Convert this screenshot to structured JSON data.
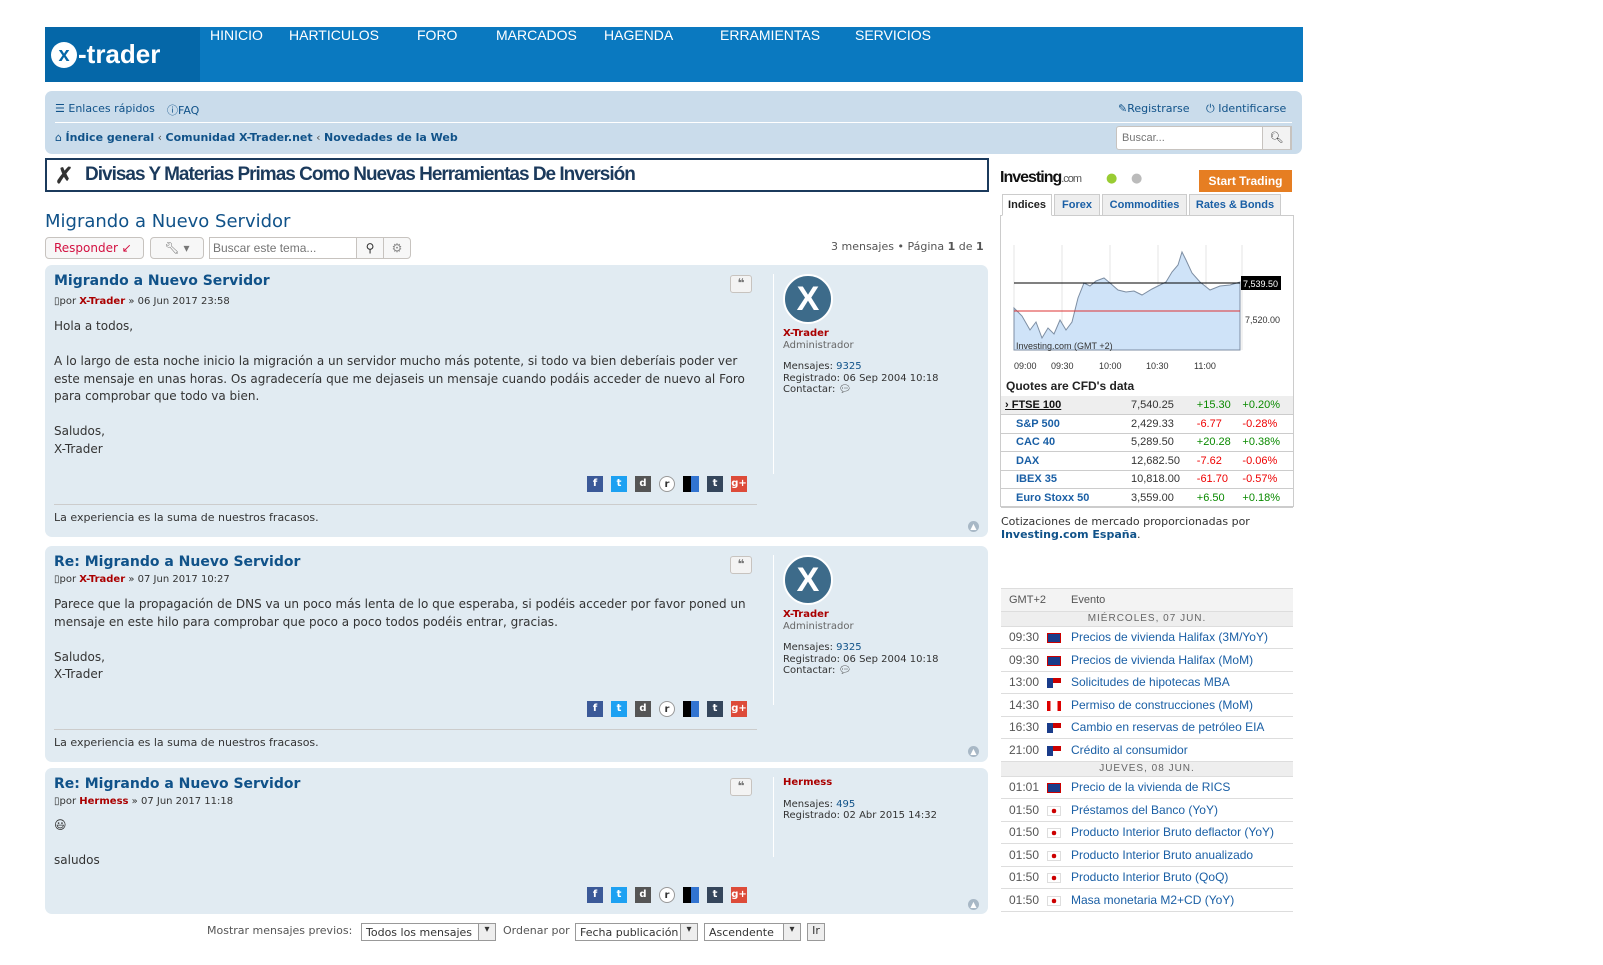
{
  "header": {
    "logo": "x-trader",
    "nav": [
      "HINICIO",
      "HARTICULOS",
      "FORO",
      "MARCADOS",
      "HAGENDA",
      "ERRAMIENTAS",
      "SERVICIOS"
    ]
  },
  "navbar": {
    "quick_links": "Enlaces rápidos",
    "faq": "FAQ",
    "register": "Registrarse",
    "login": "Identificarse",
    "breadcrumb": [
      "Índice general",
      "Comunidad X-Trader.net",
      "Novedades de la Web"
    ],
    "search_placeholder": "Buscar..."
  },
  "banner": "Divisas Y Materias Primas Como Nuevas Herramientas De Inversión",
  "topic": {
    "title": "Migrando a Nuevo Servidor",
    "reply": "Responder",
    "search_placeholder": "Buscar este tema...",
    "pagination_count": "3 mensajes • Página",
    "page": "1",
    "of": "de",
    "total_pages": "1"
  },
  "posts": [
    {
      "title": "Migrando a Nuevo Servidor",
      "by": "por",
      "author": "X-Trader",
      "date": "» 06 Jun 2017 23:58",
      "body": [
        "Hola a todos,",
        "",
        "A lo largo de esta noche inicio la migración a un servidor mucho más potente, si todo va bien deberíais poder ver este mensaje en unas horas. Os agradecería que me dejaseis un mensaje cuando podáis acceder de nuevo al Foro para comprobar que todo va bien.",
        "",
        "Saludos,",
        "X-Trader"
      ],
      "signature": "La experiencia es la suma de nuestros fracasos.",
      "profile": {
        "name": "X-Trader",
        "rank": "Administrador",
        "posts_label": "Mensajes:",
        "posts": "9325",
        "reg_label": "Registrado:",
        "reg": "06 Sep 2004 10:18",
        "contact_label": "Contactar:"
      }
    },
    {
      "title": "Re: Migrando a Nuevo Servidor",
      "by": "por",
      "author": "X-Trader",
      "date": "» 07 Jun 2017 10:27",
      "body": [
        "Parece que la propagación de DNS va un poco más lenta de lo que esperaba, si podéis acceder por favor poned un mensaje en este hilo para comprobar que poco a poco todos podéis entrar, gracias.",
        "",
        "Saludos,",
        "X-Trader"
      ],
      "signature": "La experiencia es la suma de nuestros fracasos.",
      "profile": {
        "name": "X-Trader",
        "rank": "Administrador",
        "posts_label": "Mensajes:",
        "posts": "9325",
        "reg_label": "Registrado:",
        "reg": "06 Sep 2004 10:18",
        "contact_label": "Contactar:"
      }
    },
    {
      "title": "Re: Migrando a Nuevo Servidor",
      "by": "por",
      "author": "Hermess",
      "date": "» 07 Jun 2017 11:18",
      "body": [
        "😃",
        "",
        "saludos"
      ],
      "profile": {
        "name": "Hermess",
        "posts_label": "Mensajes:",
        "posts": "495",
        "reg_label": "Registrado:",
        "reg": "02 Abr 2015 14:32"
      }
    }
  ],
  "share_icons": [
    "facebook-icon",
    "twitter-icon",
    "digg-icon",
    "reddit-icon",
    "delicious-icon",
    "tumblr-icon",
    "google-plus-icon"
  ],
  "bottom": {
    "show_label": "Mostrar mensajes previos:",
    "show_value": "Todos los mensajes",
    "sort_label": "Ordenar por",
    "sort_value": "Fecha publicación",
    "order_value": "Ascendente",
    "go": "Ir"
  },
  "investing": {
    "logo": "Investing",
    "logo_suffix": ".com",
    "start": "Start Trading",
    "tabs": [
      "Indices",
      "Forex",
      "Commodities",
      "Rates & Bonds"
    ],
    "chart_watermark": "Investing.com (GMT +2)",
    "last_price": "7,539.50",
    "ref_price": "7,520.00",
    "x_ticks": [
      "09:00",
      "09:30",
      "10:00",
      "10:30",
      "11:00"
    ],
    "quotes_title": "Quotes are CFD's data",
    "quotes": [
      [
        "FTSE 100",
        "7,540.25",
        "+15.30",
        "+0.20%"
      ],
      [
        "S&P 500",
        "2,429.33",
        "-6.77",
        "-0.28%"
      ],
      [
        "CAC 40",
        "5,289.50",
        "+20.28",
        "+0.38%"
      ],
      [
        "DAX",
        "12,682.50",
        "-7.62",
        "-0.06%"
      ],
      [
        "IBEX 35",
        "10,818.00",
        "-61.70",
        "-0.57%"
      ],
      [
        "Euro Stoxx 50",
        "3,559.00",
        "+6.50",
        "+0.18%"
      ]
    ],
    "credit": "Cotizaciones de mercado proporcionadas por",
    "credit_link": "Investing.com España",
    "credit_end": "."
  },
  "calendar": {
    "col_time": "GMT+2",
    "col_event": "Evento",
    "days": [
      {
        "label": "MIÉRCOLES, 07 JUN.",
        "events": [
          [
            "09:30",
            "uk",
            "Precios de vivienda Halifax (3M/YoY)"
          ],
          [
            "09:30",
            "uk",
            "Precios de vivienda Halifax (MoM)"
          ],
          [
            "13:00",
            "us",
            "Solicitudes de hipotecas MBA"
          ],
          [
            "14:30",
            "ca",
            "Permiso de construcciones (MoM)"
          ],
          [
            "16:30",
            "us",
            "Cambio en reservas de petróleo EIA"
          ],
          [
            "21:00",
            "us",
            "Crédito al consumidor"
          ]
        ]
      },
      {
        "label": "JUEVES, 08 JUN.",
        "events": [
          [
            "01:01",
            "uk",
            "Precio de la vivienda de RICS"
          ],
          [
            "01:50",
            "jp",
            "Préstamos del Banco (YoY)"
          ],
          [
            "01:50",
            "jp",
            "Producto Interior Bruto deflactor (YoY)"
          ],
          [
            "01:50",
            "jp",
            "Producto Interior Bruto anualizado"
          ],
          [
            "01:50",
            "jp",
            "Producto Interior Bruto (QoQ)"
          ],
          [
            "01:50",
            "jp",
            "Masa monetaria M2+CD (YoY)"
          ]
        ]
      }
    ]
  }
}
